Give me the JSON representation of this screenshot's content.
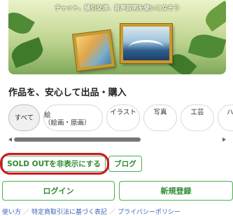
{
  "banner": {
    "caption": "チャット、値引交渉、音声説明を使いこなそう"
  },
  "section_title": "作品を、安心して出品・購入",
  "categories": [
    {
      "label": "すべて",
      "active": true
    },
    {
      "label": "絵",
      "sub": "（絵画・原画）",
      "active": false
    },
    {
      "label": "イラスト",
      "active": false
    },
    {
      "label": "写真",
      "active": false
    },
    {
      "label": "工芸",
      "active": false
    },
    {
      "label": "ハン",
      "active": false
    }
  ],
  "actions": {
    "soldout_label": "SOLD OUTを非表示にする",
    "blog_label": "ブログ"
  },
  "auth": {
    "login_label": "ログイン",
    "signup_label": "新規登録"
  },
  "footer": {
    "links": [
      "使い方",
      "特定商取引法に基づく表記",
      "プライバシーポリシー"
    ],
    "separator": "／"
  },
  "colors": {
    "accent_green": "#4caf50",
    "highlight_red": "#d01622",
    "link_blue": "#3b62b8"
  }
}
